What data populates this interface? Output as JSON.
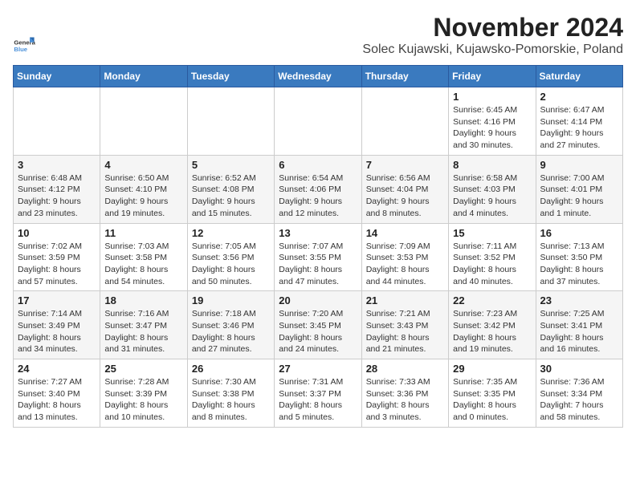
{
  "logo": {
    "general": "General",
    "blue": "Blue"
  },
  "header": {
    "month_title": "November 2024",
    "location": "Solec Kujawski, Kujawsko-Pomorskie, Poland"
  },
  "weekdays": [
    "Sunday",
    "Monday",
    "Tuesday",
    "Wednesday",
    "Thursday",
    "Friday",
    "Saturday"
  ],
  "weeks": [
    [
      {
        "day": "",
        "sunrise": "",
        "sunset": "",
        "daylight": ""
      },
      {
        "day": "",
        "sunrise": "",
        "sunset": "",
        "daylight": ""
      },
      {
        "day": "",
        "sunrise": "",
        "sunset": "",
        "daylight": ""
      },
      {
        "day": "",
        "sunrise": "",
        "sunset": "",
        "daylight": ""
      },
      {
        "day": "",
        "sunrise": "",
        "sunset": "",
        "daylight": ""
      },
      {
        "day": "1",
        "sunrise": "Sunrise: 6:45 AM",
        "sunset": "Sunset: 4:16 PM",
        "daylight": "Daylight: 9 hours and 30 minutes."
      },
      {
        "day": "2",
        "sunrise": "Sunrise: 6:47 AM",
        "sunset": "Sunset: 4:14 PM",
        "daylight": "Daylight: 9 hours and 27 minutes."
      }
    ],
    [
      {
        "day": "3",
        "sunrise": "Sunrise: 6:48 AM",
        "sunset": "Sunset: 4:12 PM",
        "daylight": "Daylight: 9 hours and 23 minutes."
      },
      {
        "day": "4",
        "sunrise": "Sunrise: 6:50 AM",
        "sunset": "Sunset: 4:10 PM",
        "daylight": "Daylight: 9 hours and 19 minutes."
      },
      {
        "day": "5",
        "sunrise": "Sunrise: 6:52 AM",
        "sunset": "Sunset: 4:08 PM",
        "daylight": "Daylight: 9 hours and 15 minutes."
      },
      {
        "day": "6",
        "sunrise": "Sunrise: 6:54 AM",
        "sunset": "Sunset: 4:06 PM",
        "daylight": "Daylight: 9 hours and 12 minutes."
      },
      {
        "day": "7",
        "sunrise": "Sunrise: 6:56 AM",
        "sunset": "Sunset: 4:04 PM",
        "daylight": "Daylight: 9 hours and 8 minutes."
      },
      {
        "day": "8",
        "sunrise": "Sunrise: 6:58 AM",
        "sunset": "Sunset: 4:03 PM",
        "daylight": "Daylight: 9 hours and 4 minutes."
      },
      {
        "day": "9",
        "sunrise": "Sunrise: 7:00 AM",
        "sunset": "Sunset: 4:01 PM",
        "daylight": "Daylight: 9 hours and 1 minute."
      }
    ],
    [
      {
        "day": "10",
        "sunrise": "Sunrise: 7:02 AM",
        "sunset": "Sunset: 3:59 PM",
        "daylight": "Daylight: 8 hours and 57 minutes."
      },
      {
        "day": "11",
        "sunrise": "Sunrise: 7:03 AM",
        "sunset": "Sunset: 3:58 PM",
        "daylight": "Daylight: 8 hours and 54 minutes."
      },
      {
        "day": "12",
        "sunrise": "Sunrise: 7:05 AM",
        "sunset": "Sunset: 3:56 PM",
        "daylight": "Daylight: 8 hours and 50 minutes."
      },
      {
        "day": "13",
        "sunrise": "Sunrise: 7:07 AM",
        "sunset": "Sunset: 3:55 PM",
        "daylight": "Daylight: 8 hours and 47 minutes."
      },
      {
        "day": "14",
        "sunrise": "Sunrise: 7:09 AM",
        "sunset": "Sunset: 3:53 PM",
        "daylight": "Daylight: 8 hours and 44 minutes."
      },
      {
        "day": "15",
        "sunrise": "Sunrise: 7:11 AM",
        "sunset": "Sunset: 3:52 PM",
        "daylight": "Daylight: 8 hours and 40 minutes."
      },
      {
        "day": "16",
        "sunrise": "Sunrise: 7:13 AM",
        "sunset": "Sunset: 3:50 PM",
        "daylight": "Daylight: 8 hours and 37 minutes."
      }
    ],
    [
      {
        "day": "17",
        "sunrise": "Sunrise: 7:14 AM",
        "sunset": "Sunset: 3:49 PM",
        "daylight": "Daylight: 8 hours and 34 minutes."
      },
      {
        "day": "18",
        "sunrise": "Sunrise: 7:16 AM",
        "sunset": "Sunset: 3:47 PM",
        "daylight": "Daylight: 8 hours and 31 minutes."
      },
      {
        "day": "19",
        "sunrise": "Sunrise: 7:18 AM",
        "sunset": "Sunset: 3:46 PM",
        "daylight": "Daylight: 8 hours and 27 minutes."
      },
      {
        "day": "20",
        "sunrise": "Sunrise: 7:20 AM",
        "sunset": "Sunset: 3:45 PM",
        "daylight": "Daylight: 8 hours and 24 minutes."
      },
      {
        "day": "21",
        "sunrise": "Sunrise: 7:21 AM",
        "sunset": "Sunset: 3:43 PM",
        "daylight": "Daylight: 8 hours and 21 minutes."
      },
      {
        "day": "22",
        "sunrise": "Sunrise: 7:23 AM",
        "sunset": "Sunset: 3:42 PM",
        "daylight": "Daylight: 8 hours and 19 minutes."
      },
      {
        "day": "23",
        "sunrise": "Sunrise: 7:25 AM",
        "sunset": "Sunset: 3:41 PM",
        "daylight": "Daylight: 8 hours and 16 minutes."
      }
    ],
    [
      {
        "day": "24",
        "sunrise": "Sunrise: 7:27 AM",
        "sunset": "Sunset: 3:40 PM",
        "daylight": "Daylight: 8 hours and 13 minutes."
      },
      {
        "day": "25",
        "sunrise": "Sunrise: 7:28 AM",
        "sunset": "Sunset: 3:39 PM",
        "daylight": "Daylight: 8 hours and 10 minutes."
      },
      {
        "day": "26",
        "sunrise": "Sunrise: 7:30 AM",
        "sunset": "Sunset: 3:38 PM",
        "daylight": "Daylight: 8 hours and 8 minutes."
      },
      {
        "day": "27",
        "sunrise": "Sunrise: 7:31 AM",
        "sunset": "Sunset: 3:37 PM",
        "daylight": "Daylight: 8 hours and 5 minutes."
      },
      {
        "day": "28",
        "sunrise": "Sunrise: 7:33 AM",
        "sunset": "Sunset: 3:36 PM",
        "daylight": "Daylight: 8 hours and 3 minutes."
      },
      {
        "day": "29",
        "sunrise": "Sunrise: 7:35 AM",
        "sunset": "Sunset: 3:35 PM",
        "daylight": "Daylight: 8 hours and 0 minutes."
      },
      {
        "day": "30",
        "sunrise": "Sunrise: 7:36 AM",
        "sunset": "Sunset: 3:34 PM",
        "daylight": "Daylight: 7 hours and 58 minutes."
      }
    ]
  ]
}
